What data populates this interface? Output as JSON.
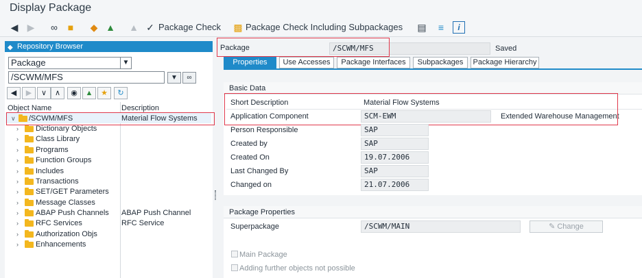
{
  "window": {
    "title": "Display Package"
  },
  "toolbar": {
    "package_check": "Package Check",
    "package_check_sub": "Package Check Including Subpackages"
  },
  "left": {
    "header": "Repository Browser",
    "object_type": "Package",
    "path": "/SCWM/MFS",
    "columns": {
      "name": "Object Name",
      "desc": "Description"
    },
    "tree": [
      {
        "label": "/SCWM/MFS",
        "desc": "Material Flow Systems",
        "level": 0,
        "expanded": true
      },
      {
        "label": "Dictionary Objects",
        "desc": "",
        "level": 1
      },
      {
        "label": "Class Library",
        "desc": "",
        "level": 1
      },
      {
        "label": "Programs",
        "desc": "",
        "level": 1
      },
      {
        "label": "Function Groups",
        "desc": "",
        "level": 1
      },
      {
        "label": "Includes",
        "desc": "",
        "level": 1
      },
      {
        "label": "Transactions",
        "desc": "",
        "level": 1
      },
      {
        "label": "SET/GET Parameters",
        "desc": "",
        "level": 1
      },
      {
        "label": "Message Classes",
        "desc": "",
        "level": 1
      },
      {
        "label": "ABAP Push Channels",
        "desc": "ABAP Push Channel",
        "level": 1
      },
      {
        "label": "RFC Services",
        "desc": "RFC Service",
        "level": 1
      },
      {
        "label": "Authorization Objs",
        "desc": "",
        "level": 1
      },
      {
        "label": "Enhancements",
        "desc": "",
        "level": 1
      }
    ]
  },
  "header": {
    "package_label": "Package",
    "package_value": "/SCWM/MFS",
    "status": "Saved"
  },
  "tabs": [
    "Properties",
    "Use Accesses",
    "Package Interfaces",
    "Subpackages",
    "Package Hierarchy"
  ],
  "basic": {
    "title": "Basic Data",
    "short_desc_label": "Short Description",
    "short_desc_value": "Material Flow Systems",
    "app_comp_label": "Application Component",
    "app_comp_value": "SCM-EWM",
    "app_comp_text": "Extended Warehouse Management",
    "person_label": "Person Responsible",
    "person_value": "SAP",
    "created_by_label": "Created by",
    "created_by_value": "SAP",
    "created_on_label": "Created On",
    "created_on_value": "19.07.2006",
    "changed_by_label": "Last Changed By",
    "changed_by_value": "SAP",
    "changed_on_label": "Changed on",
    "changed_on_value": "21.07.2006"
  },
  "props": {
    "title": "Package Properties",
    "super_label": "Superpackage",
    "super_value": "/SCWM/MAIN",
    "change_label": "Change",
    "main_package": "Main Package",
    "adding_further": "Adding further objects not possible"
  },
  "colors": {
    "accent": "#1f8ac9",
    "highlight": "#e0374a",
    "folder": "#f3b71f"
  }
}
